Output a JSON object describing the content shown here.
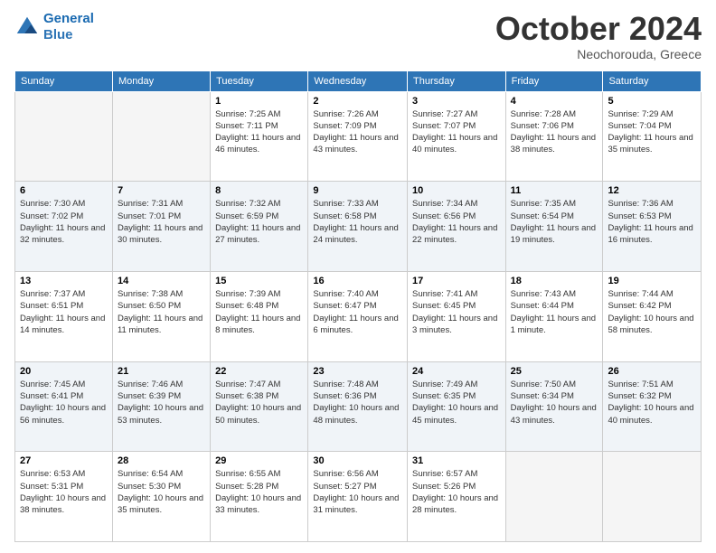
{
  "header": {
    "logo_line1": "General",
    "logo_line2": "Blue",
    "month": "October 2024",
    "location": "Neochorouda, Greece"
  },
  "weekdays": [
    "Sunday",
    "Monday",
    "Tuesday",
    "Wednesday",
    "Thursday",
    "Friday",
    "Saturday"
  ],
  "weeks": [
    [
      {
        "day": "",
        "sunrise": "",
        "sunset": "",
        "daylight": ""
      },
      {
        "day": "",
        "sunrise": "",
        "sunset": "",
        "daylight": ""
      },
      {
        "day": "1",
        "sunrise": "Sunrise: 7:25 AM",
        "sunset": "Sunset: 7:11 PM",
        "daylight": "Daylight: 11 hours and 46 minutes."
      },
      {
        "day": "2",
        "sunrise": "Sunrise: 7:26 AM",
        "sunset": "Sunset: 7:09 PM",
        "daylight": "Daylight: 11 hours and 43 minutes."
      },
      {
        "day": "3",
        "sunrise": "Sunrise: 7:27 AM",
        "sunset": "Sunset: 7:07 PM",
        "daylight": "Daylight: 11 hours and 40 minutes."
      },
      {
        "day": "4",
        "sunrise": "Sunrise: 7:28 AM",
        "sunset": "Sunset: 7:06 PM",
        "daylight": "Daylight: 11 hours and 38 minutes."
      },
      {
        "day": "5",
        "sunrise": "Sunrise: 7:29 AM",
        "sunset": "Sunset: 7:04 PM",
        "daylight": "Daylight: 11 hours and 35 minutes."
      }
    ],
    [
      {
        "day": "6",
        "sunrise": "Sunrise: 7:30 AM",
        "sunset": "Sunset: 7:02 PM",
        "daylight": "Daylight: 11 hours and 32 minutes."
      },
      {
        "day": "7",
        "sunrise": "Sunrise: 7:31 AM",
        "sunset": "Sunset: 7:01 PM",
        "daylight": "Daylight: 11 hours and 30 minutes."
      },
      {
        "day": "8",
        "sunrise": "Sunrise: 7:32 AM",
        "sunset": "Sunset: 6:59 PM",
        "daylight": "Daylight: 11 hours and 27 minutes."
      },
      {
        "day": "9",
        "sunrise": "Sunrise: 7:33 AM",
        "sunset": "Sunset: 6:58 PM",
        "daylight": "Daylight: 11 hours and 24 minutes."
      },
      {
        "day": "10",
        "sunrise": "Sunrise: 7:34 AM",
        "sunset": "Sunset: 6:56 PM",
        "daylight": "Daylight: 11 hours and 22 minutes."
      },
      {
        "day": "11",
        "sunrise": "Sunrise: 7:35 AM",
        "sunset": "Sunset: 6:54 PM",
        "daylight": "Daylight: 11 hours and 19 minutes."
      },
      {
        "day": "12",
        "sunrise": "Sunrise: 7:36 AM",
        "sunset": "Sunset: 6:53 PM",
        "daylight": "Daylight: 11 hours and 16 minutes."
      }
    ],
    [
      {
        "day": "13",
        "sunrise": "Sunrise: 7:37 AM",
        "sunset": "Sunset: 6:51 PM",
        "daylight": "Daylight: 11 hours and 14 minutes."
      },
      {
        "day": "14",
        "sunrise": "Sunrise: 7:38 AM",
        "sunset": "Sunset: 6:50 PM",
        "daylight": "Daylight: 11 hours and 11 minutes."
      },
      {
        "day": "15",
        "sunrise": "Sunrise: 7:39 AM",
        "sunset": "Sunset: 6:48 PM",
        "daylight": "Daylight: 11 hours and 8 minutes."
      },
      {
        "day": "16",
        "sunrise": "Sunrise: 7:40 AM",
        "sunset": "Sunset: 6:47 PM",
        "daylight": "Daylight: 11 hours and 6 minutes."
      },
      {
        "day": "17",
        "sunrise": "Sunrise: 7:41 AM",
        "sunset": "Sunset: 6:45 PM",
        "daylight": "Daylight: 11 hours and 3 minutes."
      },
      {
        "day": "18",
        "sunrise": "Sunrise: 7:43 AM",
        "sunset": "Sunset: 6:44 PM",
        "daylight": "Daylight: 11 hours and 1 minute."
      },
      {
        "day": "19",
        "sunrise": "Sunrise: 7:44 AM",
        "sunset": "Sunset: 6:42 PM",
        "daylight": "Daylight: 10 hours and 58 minutes."
      }
    ],
    [
      {
        "day": "20",
        "sunrise": "Sunrise: 7:45 AM",
        "sunset": "Sunset: 6:41 PM",
        "daylight": "Daylight: 10 hours and 56 minutes."
      },
      {
        "day": "21",
        "sunrise": "Sunrise: 7:46 AM",
        "sunset": "Sunset: 6:39 PM",
        "daylight": "Daylight: 10 hours and 53 minutes."
      },
      {
        "day": "22",
        "sunrise": "Sunrise: 7:47 AM",
        "sunset": "Sunset: 6:38 PM",
        "daylight": "Daylight: 10 hours and 50 minutes."
      },
      {
        "day": "23",
        "sunrise": "Sunrise: 7:48 AM",
        "sunset": "Sunset: 6:36 PM",
        "daylight": "Daylight: 10 hours and 48 minutes."
      },
      {
        "day": "24",
        "sunrise": "Sunrise: 7:49 AM",
        "sunset": "Sunset: 6:35 PM",
        "daylight": "Daylight: 10 hours and 45 minutes."
      },
      {
        "day": "25",
        "sunrise": "Sunrise: 7:50 AM",
        "sunset": "Sunset: 6:34 PM",
        "daylight": "Daylight: 10 hours and 43 minutes."
      },
      {
        "day": "26",
        "sunrise": "Sunrise: 7:51 AM",
        "sunset": "Sunset: 6:32 PM",
        "daylight": "Daylight: 10 hours and 40 minutes."
      }
    ],
    [
      {
        "day": "27",
        "sunrise": "Sunrise: 6:53 AM",
        "sunset": "Sunset: 5:31 PM",
        "daylight": "Daylight: 10 hours and 38 minutes."
      },
      {
        "day": "28",
        "sunrise": "Sunrise: 6:54 AM",
        "sunset": "Sunset: 5:30 PM",
        "daylight": "Daylight: 10 hours and 35 minutes."
      },
      {
        "day": "29",
        "sunrise": "Sunrise: 6:55 AM",
        "sunset": "Sunset: 5:28 PM",
        "daylight": "Daylight: 10 hours and 33 minutes."
      },
      {
        "day": "30",
        "sunrise": "Sunrise: 6:56 AM",
        "sunset": "Sunset: 5:27 PM",
        "daylight": "Daylight: 10 hours and 31 minutes."
      },
      {
        "day": "31",
        "sunrise": "Sunrise: 6:57 AM",
        "sunset": "Sunset: 5:26 PM",
        "daylight": "Daylight: 10 hours and 28 minutes."
      },
      {
        "day": "",
        "sunrise": "",
        "sunset": "",
        "daylight": ""
      },
      {
        "day": "",
        "sunrise": "",
        "sunset": "",
        "daylight": ""
      }
    ]
  ]
}
